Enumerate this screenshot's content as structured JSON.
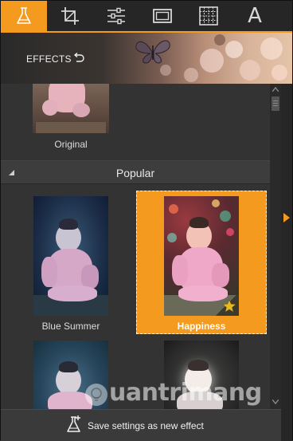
{
  "toolbar": {
    "tools": [
      {
        "icon": "flask-icon",
        "active": true
      },
      {
        "icon": "crop-icon"
      },
      {
        "icon": "sliders-icon"
      },
      {
        "icon": "frame-icon"
      },
      {
        "icon": "texture-icon"
      },
      {
        "icon": "text-icon",
        "letter": "A"
      }
    ],
    "accent": "#f39a1f"
  },
  "header": {
    "title": "EFFECTS"
  },
  "original": {
    "label": "Original"
  },
  "section": {
    "title": "Popular"
  },
  "effects": [
    {
      "label": "Blue Summer",
      "selected": false
    },
    {
      "label": "Happiness",
      "selected": true,
      "premium": true
    }
  ],
  "footer": {
    "label": "Save settings as new effect"
  },
  "watermark": {
    "text": "uantrimang"
  }
}
